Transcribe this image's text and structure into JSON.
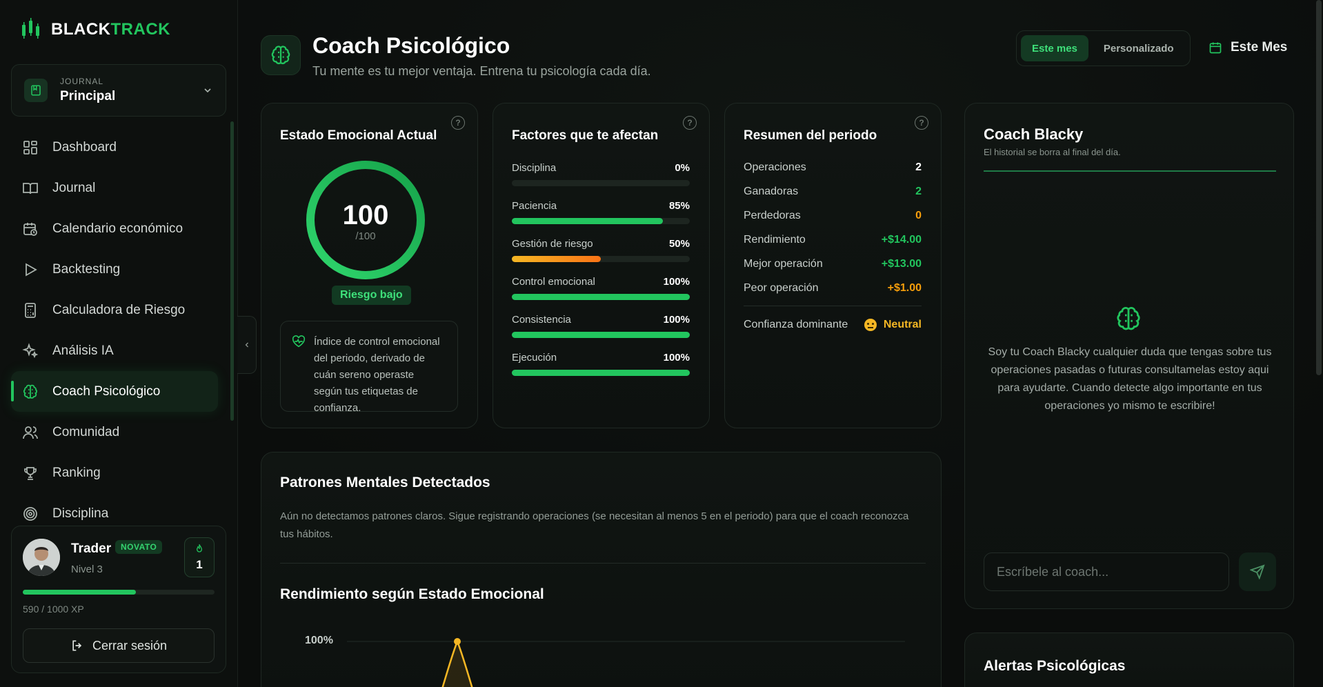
{
  "brand": {
    "name_part1": "BLACK",
    "name_part2": "TRACK",
    "accent": "#22c55e"
  },
  "journal": {
    "label": "JOURNAL",
    "name": "Principal"
  },
  "nav": [
    {
      "label": "Dashboard",
      "icon": "dashboard-icon"
    },
    {
      "label": "Journal",
      "icon": "book-icon"
    },
    {
      "label": "Calendario económico",
      "icon": "calendar-clock-icon"
    },
    {
      "label": "Backtesting",
      "icon": "play-icon"
    },
    {
      "label": "Calculadora de Riesgo",
      "icon": "calculator-icon"
    },
    {
      "label": "Análisis IA",
      "icon": "sparkles-icon"
    },
    {
      "label": "Coach Psicológico",
      "icon": "brain-icon",
      "active": true
    },
    {
      "label": "Comunidad",
      "icon": "users-icon"
    },
    {
      "label": "Ranking",
      "icon": "trophy-icon"
    },
    {
      "label": "Disciplina",
      "icon": "target-icon"
    }
  ],
  "user": {
    "name": "Trader",
    "badge": "NOVATO",
    "level": "Nivel 3",
    "streak": "1",
    "xp_text": "590 / 1000 XP",
    "xp_progress": 0.59,
    "logout": "Cerrar sesión"
  },
  "header": {
    "title": "Coach Psicológico",
    "subtitle": "Tu mente es tu mejor ventaja. Entrena tu psicología cada día.",
    "range_options": [
      "Este mes",
      "Personalizado"
    ],
    "selected_range": "Este mes",
    "month": "Este Mes"
  },
  "emotional": {
    "title": "Estado Emocional Actual",
    "value": "100",
    "max": "/100",
    "progress": 1.0,
    "risk": "Riesgo bajo",
    "info": "Índice de control emocional del periodo, derivado de cuán sereno operaste según tus etiquetas de confianza."
  },
  "factors": {
    "title": "Factores que te afectan",
    "items": [
      {
        "label": "Disciplina",
        "value": "0%",
        "pct": 0,
        "color": "#22c55e"
      },
      {
        "label": "Paciencia",
        "value": "85%",
        "pct": 85,
        "color": "#22c55e"
      },
      {
        "label": "Gestión de riesgo",
        "value": "50%",
        "pct": 50,
        "color": "gradient-orange"
      },
      {
        "label": "Control emocional",
        "value": "100%",
        "pct": 100,
        "color": "#22c55e"
      },
      {
        "label": "Consistencia",
        "value": "100%",
        "pct": 100,
        "color": "#22c55e"
      },
      {
        "label": "Ejecución",
        "value": "100%",
        "pct": 100,
        "color": "#22c55e"
      }
    ]
  },
  "summary": {
    "title": "Resumen del periodo",
    "rows": [
      {
        "label": "Operaciones",
        "value": "2",
        "color": "#ffffff"
      },
      {
        "label": "Ganadoras",
        "value": "2",
        "color": "#22c55e"
      },
      {
        "label": "Perdedoras",
        "value": "0",
        "color": "#f59e0b"
      },
      {
        "label": "Rendimiento",
        "value": "+$14.00",
        "color": "#22c55e"
      },
      {
        "label": "Mejor operación",
        "value": "+$13.00",
        "color": "#22c55e"
      },
      {
        "label": "Peor operación",
        "value": "+$1.00",
        "color": "#f59e0b"
      }
    ],
    "confidence_label": "Confianza dominante",
    "confidence_value": "Neutral"
  },
  "coach": {
    "title": "Coach Blacky",
    "subtitle": "El historial se borra al final del día.",
    "message": "Soy tu Coach Blacky cualquier duda que tengas sobre tus operaciones pasadas o futuras consultamelas estoy aqui para ayudarte. Cuando detecte algo importante en tus operaciones yo mismo te escribire!",
    "input_placeholder": "Escríbele al coach..."
  },
  "patterns": {
    "title": "Patrones Mentales Detectados",
    "text": "Aún no detectamos patrones claros. Sigue registrando operaciones (se necesitan al menos 5 en el periodo) para que el coach reconozca tus hábitos."
  },
  "performance": {
    "title": "Rendimiento según Estado Emocional"
  },
  "chart_data": {
    "type": "area",
    "ytick_visible": "100%",
    "peak_value": 100,
    "series_color": "#f5b724"
  },
  "alerts": {
    "title": "Alertas Psicológicas"
  }
}
